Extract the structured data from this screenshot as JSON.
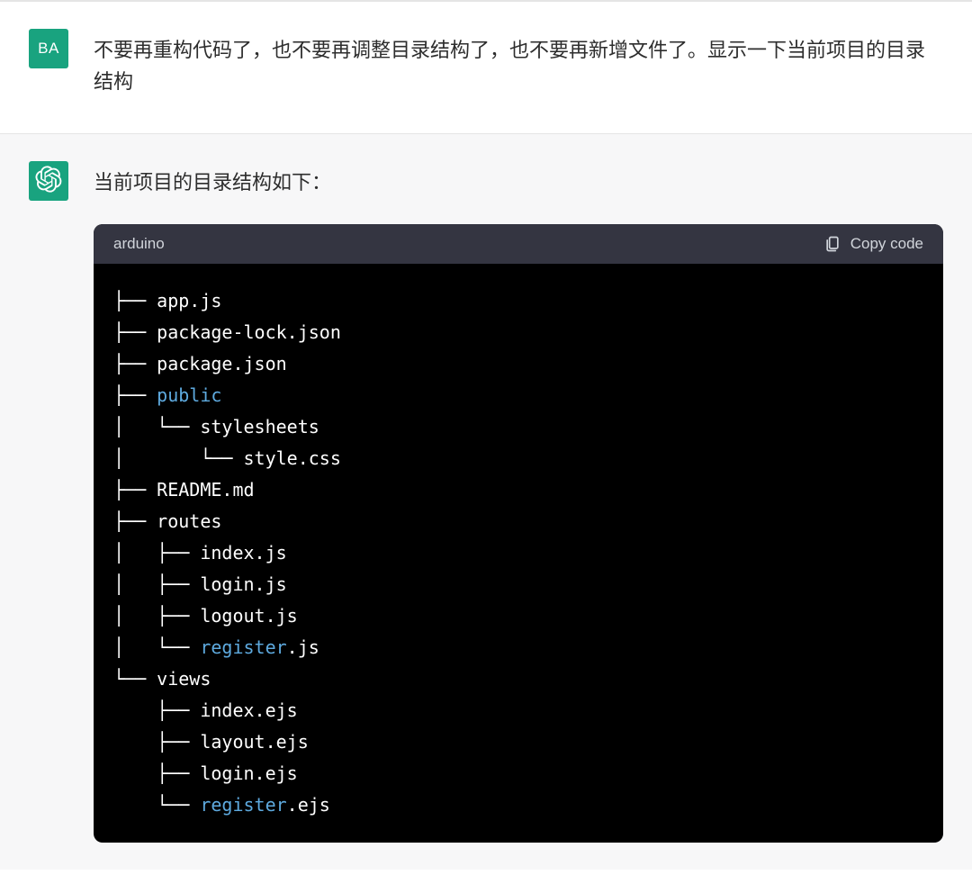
{
  "user": {
    "avatar_text": "BA",
    "message": "不要再重构代码了，也不要再调整目录结构了，也不要再新增文件了。显示一下当前项目的目录结构"
  },
  "assistant": {
    "intro_text": "当前项目的目录结构如下：",
    "code_language": "arduino",
    "copy_label": "Copy code",
    "tree": {
      "entries": [
        {
          "prefix": "├── ",
          "name": "app.js",
          "highlight": false
        },
        {
          "prefix": "├── ",
          "name": "package-lock.json",
          "highlight": false
        },
        {
          "prefix": "├── ",
          "name": "package.json",
          "highlight": false
        },
        {
          "prefix": "├── ",
          "name": "public",
          "highlight": true
        },
        {
          "prefix": "│   └── ",
          "name": "stylesheets",
          "highlight": false
        },
        {
          "prefix": "│       └── ",
          "name": "style.css",
          "highlight": false
        },
        {
          "prefix": "├── ",
          "name": "README.md",
          "highlight": false
        },
        {
          "prefix": "├── ",
          "name": "routes",
          "highlight": false
        },
        {
          "prefix": "│   ├── ",
          "name": "index.js",
          "highlight": false
        },
        {
          "prefix": "│   ├── ",
          "name": "login.js",
          "highlight": false
        },
        {
          "prefix": "│   ├── ",
          "name": "logout.js",
          "highlight": false
        },
        {
          "prefix": "│   └── ",
          "name_parts": [
            {
              "t": "register",
              "hl": true
            },
            {
              "t": ".js",
              "hl": false
            }
          ]
        },
        {
          "prefix": "└── ",
          "name": "views",
          "highlight": false
        },
        {
          "prefix": "    ├── ",
          "name": "index.ejs",
          "highlight": false
        },
        {
          "prefix": "    ├── ",
          "name": "layout.ejs",
          "highlight": false
        },
        {
          "prefix": "    ├── ",
          "name": "login.ejs",
          "highlight": false
        },
        {
          "prefix": "    └── ",
          "name_parts": [
            {
              "t": "register",
              "hl": true
            },
            {
              "t": ".ejs",
              "hl": false
            }
          ]
        }
      ]
    }
  },
  "colors": {
    "accent": "#19a37f",
    "code_bg": "#000000",
    "code_header_bg": "#343541",
    "keyword": "#5eaadf"
  }
}
